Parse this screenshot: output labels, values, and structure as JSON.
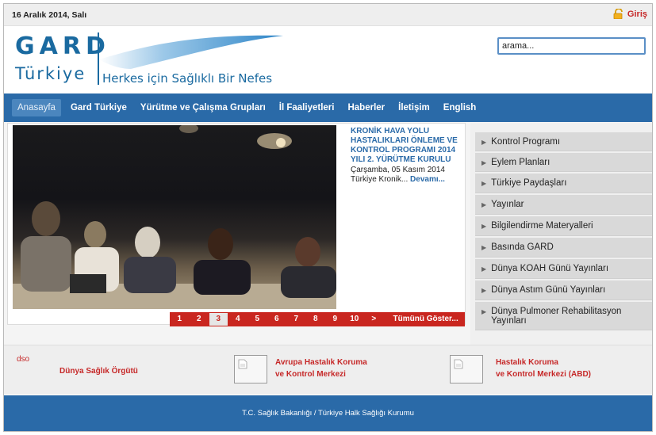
{
  "topbar": {
    "date": "16 Aralık 2014, Salı",
    "login_label": "Giriş",
    "login_icon": "lock-icon"
  },
  "header": {
    "logo_gard": "GARD",
    "logo_turkiye": "Türkiye",
    "slogan": "Herkes için Sağlıklı Bir Nefes",
    "search_value": "arama..."
  },
  "nav": {
    "items": [
      {
        "label": "Anasayfa",
        "active": true
      },
      {
        "label": "Gard Türkiye"
      },
      {
        "label": "Yürütme ve Çalışma Grupları"
      },
      {
        "label": "İl Faaliyetleri"
      },
      {
        "label": "Haberler"
      },
      {
        "label": "İletişim"
      },
      {
        "label": "English"
      }
    ]
  },
  "slider": {
    "title": "KRONİK HAVA YOLU HASTALIKLARI ÖNLEME VE KONTROL PROGRAMI 2014 YILI 2. YÜRÜTME KURULU",
    "date": "Çarşamba, 05 Kasım 2014",
    "summary": "Türkiye Kronik...",
    "more_label": "Devamı...",
    "pages": [
      "1",
      "2",
      "3",
      "4",
      "5",
      "6",
      "7",
      "8",
      "9",
      "10"
    ],
    "current_page": "3",
    "next_label": ">",
    "all_label": "Tümünü Göster..."
  },
  "right_menu": {
    "items": [
      "Kontrol Programı",
      "Eylem Planları",
      "Türkiye Paydaşları",
      "Yayınlar",
      "Bilgilendirme Materyalleri",
      "Basında GARD",
      "Dünya KOAH Günü Yayınları",
      "Dünya Astım Günü Yayınları",
      "Dünya Pulmoner Rehabilitasyon Yayınları"
    ]
  },
  "partners": {
    "dso_label": "dso",
    "who_label": "Dünya Sağlık Örgütü",
    "ecdc_line1": "Avrupa Hastalık Koruma",
    "ecdc_line2": "ve Kontrol Merkezi",
    "cdc_line1": "Hastalık Koruma",
    "cdc_line2": "ve Kontrol Merkezi (ABD)"
  },
  "footer": {
    "text": "T.C. Sağlık Bakanlığı / Türkiye Halk Sağlığı Kurumu"
  },
  "colors": {
    "brand_blue": "#2a6aa8",
    "logo_blue": "#1a6aa0",
    "accent_red": "#c9261f",
    "menu_gray": "#d9d9d9"
  }
}
